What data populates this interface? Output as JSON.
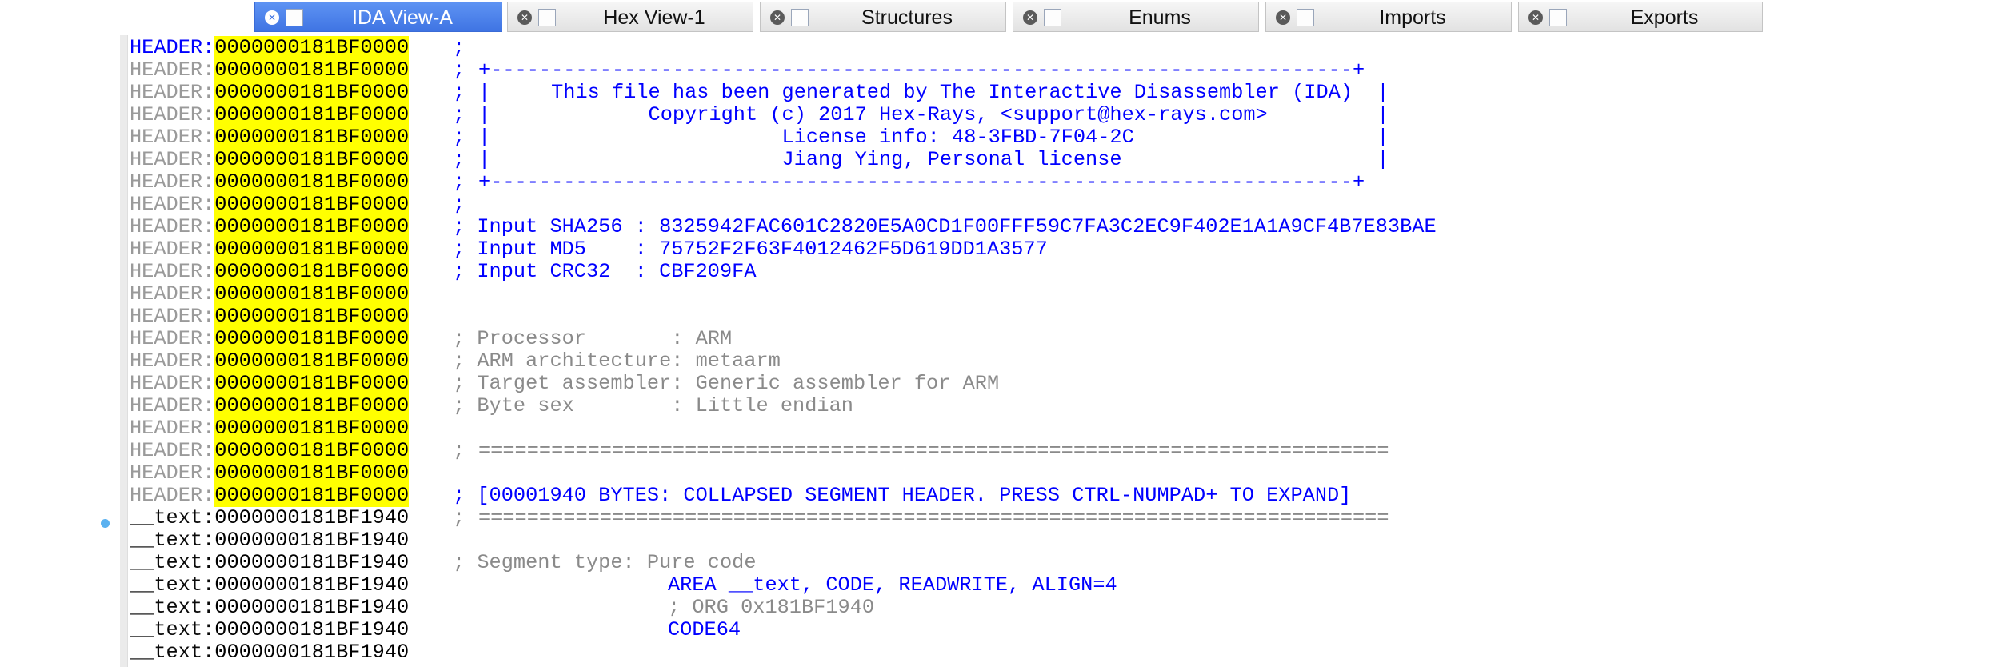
{
  "tabs": [
    {
      "label": "IDA View-A",
      "icon": "ida-view-icon",
      "active": true
    },
    {
      "label": "Hex View-1",
      "icon": "hex-view-icon",
      "active": false
    },
    {
      "label": "Structures",
      "icon": "structures-icon",
      "active": false
    },
    {
      "label": "Enums",
      "icon": "enums-icon",
      "active": false
    },
    {
      "label": "Imports",
      "icon": "imports-icon",
      "active": false
    },
    {
      "label": "Exports",
      "icon": "exports-icon",
      "active": false
    }
  ],
  "colors": {
    "address_highlight": "#ffff00",
    "comment_blue": "#0000ff",
    "comment_grey": "#8a8a8a",
    "active_tab": "#4a82ee"
  },
  "lines": [
    {
      "seg": "HEADER",
      "addr": "0000000181BF0000",
      "parts": [
        {
          "text": ";",
          "style": "blue"
        }
      ]
    },
    {
      "seg": "HEADER",
      "addr": "0000000181BF0000",
      "parts": [
        {
          "text": ";",
          "style": "blue"
        },
        {
          "text": "+-----------------------------------------------------------------------+",
          "style": "blue"
        }
      ]
    },
    {
      "seg": "HEADER",
      "addr": "0000000181BF0000",
      "parts": [
        {
          "text": ";",
          "style": "blue"
        },
        {
          "text": "|     This file has been generated by The Interactive Disassembler (IDA)  |",
          "style": "blue"
        }
      ]
    },
    {
      "seg": "HEADER",
      "addr": "0000000181BF0000",
      "parts": [
        {
          "text": ";",
          "style": "blue"
        },
        {
          "text": "|             Copyright (c) 2017 Hex-Rays, <support@hex-rays.com>         |",
          "style": "blue"
        }
      ]
    },
    {
      "seg": "HEADER",
      "addr": "0000000181BF0000",
      "parts": [
        {
          "text": ";",
          "style": "blue"
        },
        {
          "text": "|                        License info: 48-3FBD-7F04-2C                    |",
          "style": "blue"
        }
      ]
    },
    {
      "seg": "HEADER",
      "addr": "0000000181BF0000",
      "parts": [
        {
          "text": ";",
          "style": "blue"
        },
        {
          "text": "|                        Jiang Ying, Personal license                     |",
          "style": "blue"
        }
      ]
    },
    {
      "seg": "HEADER",
      "addr": "0000000181BF0000",
      "parts": [
        {
          "text": ";",
          "style": "blue"
        },
        {
          "text": "+-----------------------------------------------------------------------+",
          "style": "blue"
        }
      ]
    },
    {
      "seg": "HEADER",
      "addr": "0000000181BF0000",
      "parts": [
        {
          "text": ";",
          "style": "blue"
        }
      ]
    },
    {
      "seg": "HEADER",
      "addr": "0000000181BF0000",
      "parts": [
        {
          "text": "; Input SHA256 : 8325942FAC601C2820E5A0CD1F00FFF59C7FA3C2EC9F402E1A1A9CF4B7E83BAE",
          "style": "blue"
        }
      ]
    },
    {
      "seg": "HEADER",
      "addr": "0000000181BF0000",
      "parts": [
        {
          "text": "; Input MD5    : 75752F2F63F4012462F5D619DD1A3577",
          "style": "blue"
        }
      ]
    },
    {
      "seg": "HEADER",
      "addr": "0000000181BF0000",
      "parts": [
        {
          "text": "; Input CRC32  : CBF209FA",
          "style": "blue"
        }
      ]
    },
    {
      "seg": "HEADER",
      "addr": "0000000181BF0000",
      "parts": []
    },
    {
      "seg": "HEADER",
      "addr": "0000000181BF0000",
      "parts": []
    },
    {
      "seg": "HEADER",
      "addr": "0000000181BF0000",
      "parts": [
        {
          "text": "; Processor       : ARM",
          "style": "grey"
        }
      ]
    },
    {
      "seg": "HEADER",
      "addr": "0000000181BF0000",
      "parts": [
        {
          "text": "; ARM architecture: metaarm",
          "style": "grey"
        }
      ]
    },
    {
      "seg": "HEADER",
      "addr": "0000000181BF0000",
      "parts": [
        {
          "text": "; Target assembler: Generic assembler for ARM",
          "style": "grey"
        }
      ]
    },
    {
      "seg": "HEADER",
      "addr": "0000000181BF0000",
      "parts": [
        {
          "text": "; Byte sex        : Little endian",
          "style": "grey"
        }
      ]
    },
    {
      "seg": "HEADER",
      "addr": "0000000181BF0000",
      "parts": []
    },
    {
      "seg": "HEADER",
      "addr": "0000000181BF0000",
      "parts": [
        {
          "text": ";",
          "style": "grey"
        },
        {
          "text": "===========================================================================",
          "style": "grey"
        }
      ]
    },
    {
      "seg": "HEADER",
      "addr": "0000000181BF0000",
      "parts": []
    },
    {
      "seg": "HEADER",
      "addr": "0000000181BF0000",
      "parts": [
        {
          "text": "; [00001940 BYTES: COLLAPSED SEGMENT HEADER. PRESS CTRL-NUMPAD+ TO EXPAND]",
          "style": "blue"
        }
      ]
    },
    {
      "seg": "__text",
      "addr": "0000000181BF1940",
      "parts": [
        {
          "text": ";",
          "style": "grey"
        },
        {
          "text": "===========================================================================",
          "style": "grey"
        }
      ]
    },
    {
      "seg": "__text",
      "addr": "0000000181BF1940",
      "parts": []
    },
    {
      "seg": "__text",
      "addr": "0000000181BF1940",
      "parts": [
        {
          "text": "; Segment type: Pure code",
          "style": "grey"
        }
      ]
    },
    {
      "seg": "__text",
      "addr": "0000000181BF1940",
      "parts": [
        {
          "text": "AREA __text, CODE, READWRITE, ALIGN=4",
          "style": "blue",
          "indent": true
        }
      ]
    },
    {
      "seg": "__text",
      "addr": "0000000181BF1940",
      "parts": [
        {
          "text": "; ORG 0x181BF1940",
          "style": "grey",
          "indent": true
        }
      ]
    },
    {
      "seg": "__text",
      "addr": "0000000181BF1940",
      "parts": [
        {
          "text": "CODE64",
          "style": "blue",
          "indent": true
        }
      ]
    },
    {
      "seg": "__text",
      "addr": "0000000181BF1940",
      "parts": []
    }
  ]
}
